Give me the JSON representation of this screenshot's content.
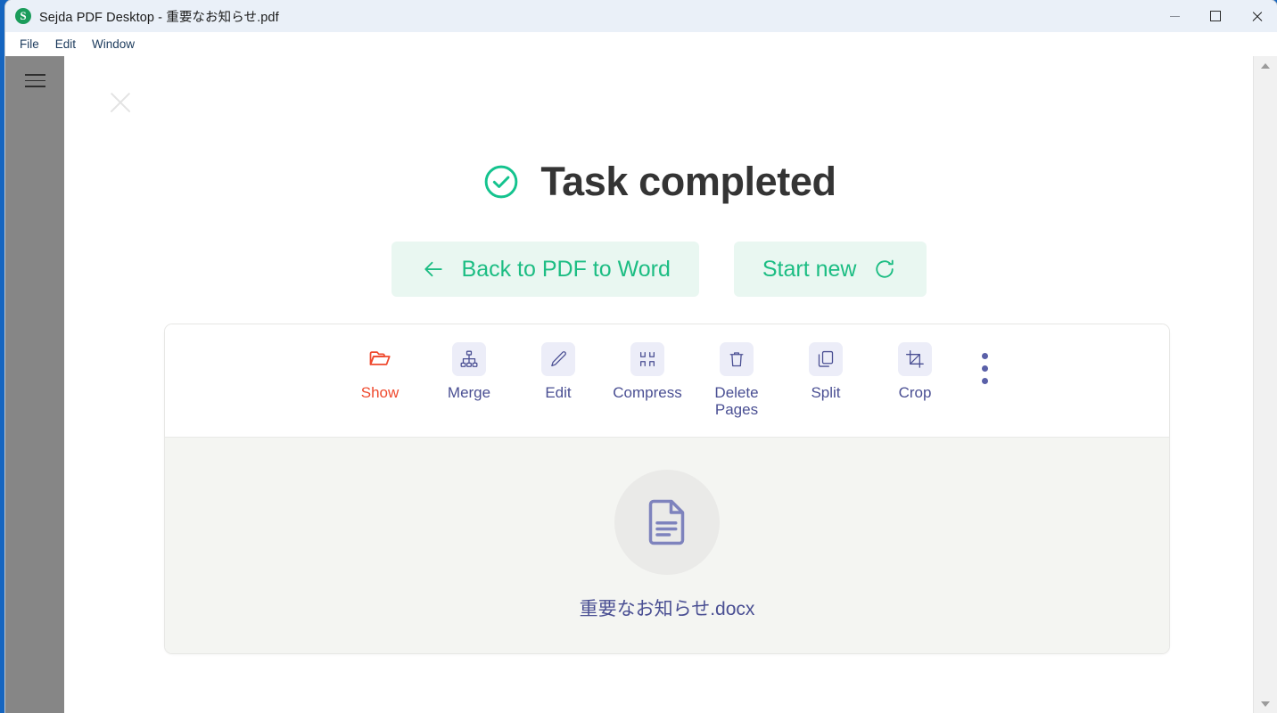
{
  "window": {
    "title": "Sejda PDF Desktop - 重要なお知らせ.pdf",
    "logo_letter": "S",
    "logo_color": "#1a9c5b",
    "controls": {
      "minimize": "minimize-button",
      "maximize": "maximize-button",
      "close": "close-button"
    }
  },
  "menubar": {
    "items": [
      {
        "label": "File"
      },
      {
        "label": "Edit"
      },
      {
        "label": "Window"
      }
    ]
  },
  "panel": {
    "close_label": "close-panel",
    "heading": "Task completed",
    "heading_icon": "check-circle-icon",
    "accent_green": "#1cbd83",
    "accent_indigo": "#4a4f93",
    "accent_orange": "#ef4a2e",
    "actions": [
      {
        "label": "Back to PDF to Word",
        "icon": "arrow-left-icon",
        "icon_side": "left"
      },
      {
        "label": "Start new",
        "icon": "refresh-icon",
        "icon_side": "right"
      }
    ]
  },
  "tools": [
    {
      "label": "Show",
      "icon": "folder-open-icon",
      "style": "accent"
    },
    {
      "label": "Merge",
      "icon": "merge-hierarchy-icon",
      "style": "normal"
    },
    {
      "label": "Edit",
      "icon": "pencil-icon",
      "style": "normal"
    },
    {
      "label": "Compress",
      "icon": "compress-icon",
      "style": "normal"
    },
    {
      "label": "Delete Pages",
      "icon": "trash-icon",
      "style": "normal"
    },
    {
      "label": "Split",
      "icon": "split-copy-icon",
      "style": "normal"
    },
    {
      "label": "Crop",
      "icon": "crop-icon",
      "style": "normal"
    }
  ],
  "overflow_menu": {
    "label": "more-options",
    "icon": "kebab-vertical-icon"
  },
  "result_file": {
    "name": "重要なお知らせ.docx",
    "icon": "document-icon"
  },
  "sidebar": {
    "menu_icon": "hamburger-menu-icon"
  },
  "scrollbar": {
    "up": "scroll-up-arrow",
    "down": "scroll-down-arrow"
  }
}
